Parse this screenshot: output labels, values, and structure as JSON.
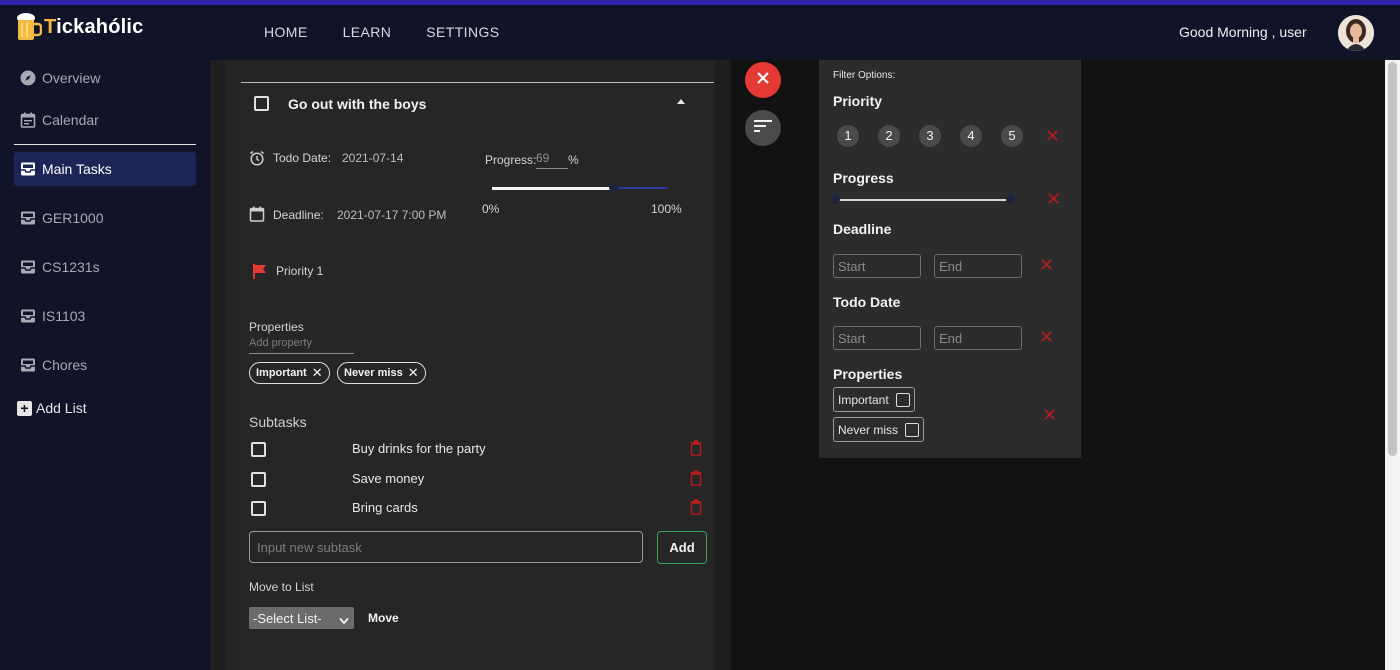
{
  "app": {
    "name_prefix": "T",
    "name_rest": "ickahólic"
  },
  "nav": {
    "home": "HOME",
    "learn": "LEARN",
    "settings": "SETTINGS"
  },
  "user": {
    "greeting": "Good Morning , user"
  },
  "sidebar": {
    "items": [
      {
        "label": "Overview",
        "icon": "compass-icon"
      },
      {
        "label": "Calendar",
        "icon": "calendar-icon"
      },
      {
        "label": "Main Tasks",
        "icon": "inbox-icon",
        "active": true
      },
      {
        "label": "GER1000",
        "icon": "inbox-icon"
      },
      {
        "label": "CS1231s",
        "icon": "inbox-icon"
      },
      {
        "label": "IS1103",
        "icon": "inbox-icon"
      },
      {
        "label": "Chores",
        "icon": "inbox-icon"
      }
    ],
    "add_list": "Add List"
  },
  "task": {
    "title": "Go out with the boys",
    "todo_date_label": "Todo Date:",
    "todo_date": "2021-07-14",
    "deadline_label": "Deadline:",
    "deadline": "2021-07-17 7:00 PM",
    "progress_label": "Progress:",
    "progress_value": "69",
    "progress_unit": "%",
    "progress_fraction": 0.69,
    "progress_min": "0%",
    "progress_max": "100%",
    "priority": "Priority 1",
    "properties_label": "Properties",
    "add_property_placeholder": "Add property",
    "tags": [
      "Important",
      "Never miss"
    ],
    "subtasks_label": "Subtasks",
    "subtasks": [
      "Buy drinks for the party",
      "Save money",
      "Bring cards"
    ],
    "new_subtask_placeholder": "Input new subtask",
    "add_button": "Add",
    "move_to_list_label": "Move to List",
    "select_list": "-Select List-",
    "move_button": "Move"
  },
  "filter": {
    "title": "Filter Options:",
    "priority_label": "Priority",
    "priorities": [
      "1",
      "2",
      "3",
      "4",
      "5"
    ],
    "progress_label": "Progress",
    "deadline_label": "Deadline",
    "todo_date_label": "Todo Date",
    "start_placeholder": "Start",
    "end_placeholder": "End",
    "properties_label": "Properties",
    "properties": [
      "Important",
      "Never miss"
    ]
  },
  "colors": {
    "accent_red": "#e53935",
    "nav_bg": "#111428",
    "active_item": "#1c2556",
    "logo_accent": "#f4b942",
    "add_border": "#3aa35a"
  }
}
